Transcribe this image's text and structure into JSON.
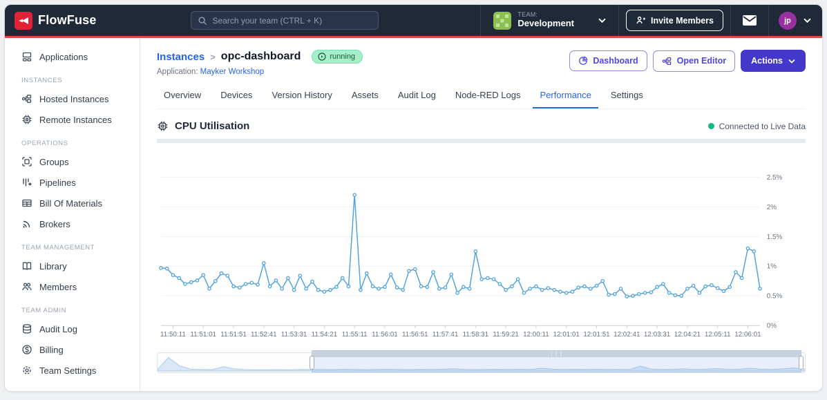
{
  "navbar": {
    "logo_text": "FlowFuse",
    "search_placeholder": "Search your team (CTRL + K)",
    "team_label": "TEAM:",
    "team_name": "Development",
    "invite_button": "Invite Members",
    "avatar_initials": "jp"
  },
  "sidebar": {
    "sections": [
      {
        "header": "",
        "items": [
          {
            "label": "Applications"
          }
        ]
      },
      {
        "header": "INSTANCES",
        "items": [
          {
            "label": "Hosted Instances"
          },
          {
            "label": "Remote Instances"
          }
        ]
      },
      {
        "header": "OPERATIONS",
        "items": [
          {
            "label": "Groups"
          },
          {
            "label": "Pipelines"
          },
          {
            "label": "Bill Of Materials"
          },
          {
            "label": "Brokers"
          }
        ]
      },
      {
        "header": "TEAM MANAGEMENT",
        "items": [
          {
            "label": "Library"
          },
          {
            "label": "Members"
          }
        ]
      },
      {
        "header": "TEAM ADMIN",
        "items": [
          {
            "label": "Audit Log"
          },
          {
            "label": "Billing"
          },
          {
            "label": "Team Settings"
          }
        ]
      }
    ]
  },
  "page": {
    "breadcrumb_parent": "Instances",
    "breadcrumb_separator": ">",
    "breadcrumb_current": "opc-dashboard",
    "status_badge": "running",
    "application_label": "Application:",
    "application_name": "Mayker Workshop",
    "buttons": {
      "dashboard": "Dashboard",
      "open_editor": "Open Editor",
      "actions": "Actions"
    }
  },
  "tabs": {
    "items": [
      "Overview",
      "Devices",
      "Version History",
      "Assets",
      "Audit Log",
      "Node-RED Logs",
      "Performance",
      "Settings"
    ],
    "active": "Performance"
  },
  "panel": {
    "title": "CPU Utilisation",
    "live_status": "Connected to Live Data"
  },
  "colors": {
    "navbar_bg": "#1f2937",
    "accent_red": "#e0473f",
    "link_blue": "#2563eb",
    "indigo": "#4338ca",
    "chart_line": "#4fa3dc",
    "badge_green": "#a5f0cb",
    "live_green": "#10b981"
  },
  "chart_data": {
    "type": "line",
    "title": "CPU Utilisation",
    "unit": "%",
    "ylim": [
      0,
      2.5
    ],
    "grid": true,
    "legend": "none",
    "y_tick_values": [
      0,
      0.5,
      1,
      1.5,
      2,
      2.5
    ],
    "y_tick_labels": [
      "0%",
      "0.5%",
      "1%",
      "1.5%",
      "2%",
      "2.5%"
    ],
    "x_ticks": [
      "11:50:11",
      "11:51:01",
      "11:51:51",
      "11:52:41",
      "11:53:31",
      "11:54:21",
      "11:55:11",
      "11:56:01",
      "11:56:51",
      "11:57:41",
      "11:58:31",
      "11:59:21",
      "12:00:11",
      "12:01:01",
      "12:01:51",
      "12:02:41",
      "12:03:31",
      "12:04:21",
      "12:05:11",
      "12:06:01"
    ],
    "x_start": "11:49:51",
    "x_interval_seconds": 10,
    "series": [
      {
        "name": "CPU",
        "color": "#4fa3dc",
        "values": [
          0.97,
          0.96,
          0.85,
          0.8,
          0.7,
          0.73,
          0.76,
          0.85,
          0.62,
          0.75,
          0.88,
          0.84,
          0.66,
          0.64,
          0.7,
          0.72,
          0.69,
          1.05,
          0.66,
          0.76,
          0.62,
          0.8,
          0.6,
          0.84,
          0.62,
          0.74,
          0.6,
          0.57,
          0.6,
          0.65,
          0.8,
          0.66,
          2.2,
          0.6,
          0.88,
          0.66,
          0.62,
          0.65,
          0.86,
          0.64,
          0.6,
          0.92,
          0.95,
          0.66,
          0.65,
          0.9,
          0.62,
          0.64,
          0.86,
          0.55,
          0.65,
          0.62,
          1.25,
          0.78,
          0.8,
          0.78,
          0.7,
          0.6,
          0.66,
          0.78,
          0.55,
          0.62,
          0.66,
          0.6,
          0.63,
          0.6,
          0.57,
          0.55,
          0.57,
          0.64,
          0.66,
          0.62,
          0.67,
          0.75,
          0.52,
          0.53,
          0.62,
          0.49,
          0.5,
          0.53,
          0.55,
          0.56,
          0.65,
          0.7,
          0.55,
          0.51,
          0.5,
          0.62,
          0.67,
          0.55,
          0.66,
          0.68,
          0.63,
          0.58,
          0.65,
          0.9,
          0.8,
          1.3,
          1.25,
          0.62
        ]
      }
    ],
    "brush": {
      "selection_start_frac": 0.238,
      "selection_end_frac": 0.995,
      "preview_values": [
        0.1,
        0.88,
        0.35,
        0.12,
        0.1,
        0.09,
        0.28,
        0.14,
        0.09,
        0.08,
        0.08,
        0.09,
        0.08,
        0.1,
        0.09,
        0.1,
        0.09,
        0.12,
        0.1,
        0.09,
        0.1,
        0.12,
        0.1,
        0.09,
        0.11,
        0.1,
        0.12,
        0.14,
        0.1,
        0.09,
        0.1,
        0.11,
        0.1,
        0.12,
        0.1,
        0.18,
        0.12,
        0.1,
        0.11,
        0.1,
        0.12,
        0.1,
        0.11,
        0.1,
        0.32,
        0.12,
        0.1,
        0.11,
        0.14,
        0.1,
        0.12,
        0.16,
        0.1,
        0.12,
        0.18,
        0.12,
        0.1,
        0.14,
        0.2,
        0.12
      ]
    }
  }
}
